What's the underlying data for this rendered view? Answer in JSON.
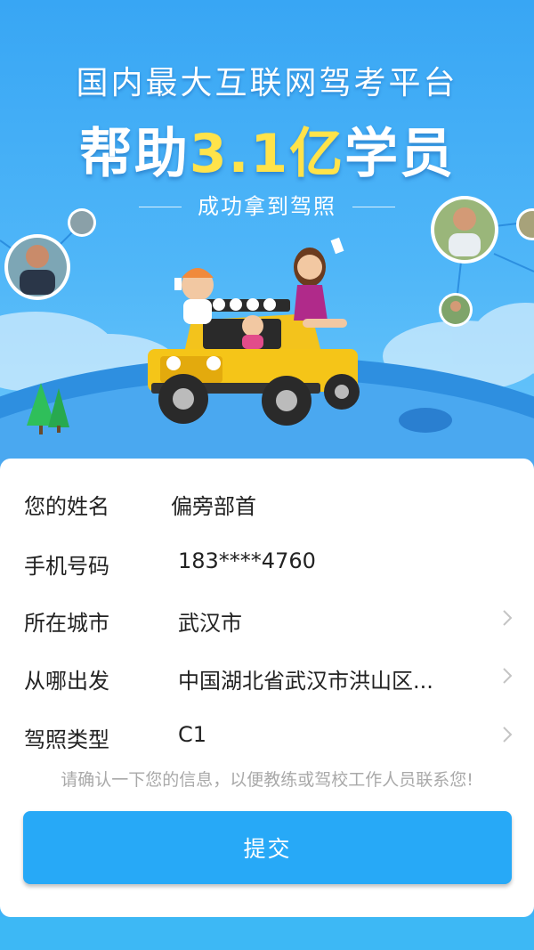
{
  "banner": {
    "headline": "国内最大互联网驾考平台",
    "main_prefix": "帮助",
    "main_highlight": "3.1亿",
    "main_suffix": "学员",
    "subline": "成功拿到驾照"
  },
  "form": {
    "fields": [
      {
        "label": "您的姓名",
        "value": "偏旁部首"
      },
      {
        "label": "手机号码",
        "value": "183****4760"
      },
      {
        "label": "所在城市",
        "value": "武汉市"
      },
      {
        "label": "从哪出发",
        "value": "中国湖北省武汉市洪山区..."
      },
      {
        "label": "驾照类型",
        "value": "C1"
      }
    ],
    "note": "请确认一下您的信息，以便教练或驾校工作人员联系您!",
    "submit_label": "提交"
  },
  "icons": {
    "chevron": "chevron-right-icon"
  },
  "colors": {
    "primary": "#27a9f7",
    "highlight": "#ffe34a",
    "hero_bg": "#38a6f4"
  }
}
